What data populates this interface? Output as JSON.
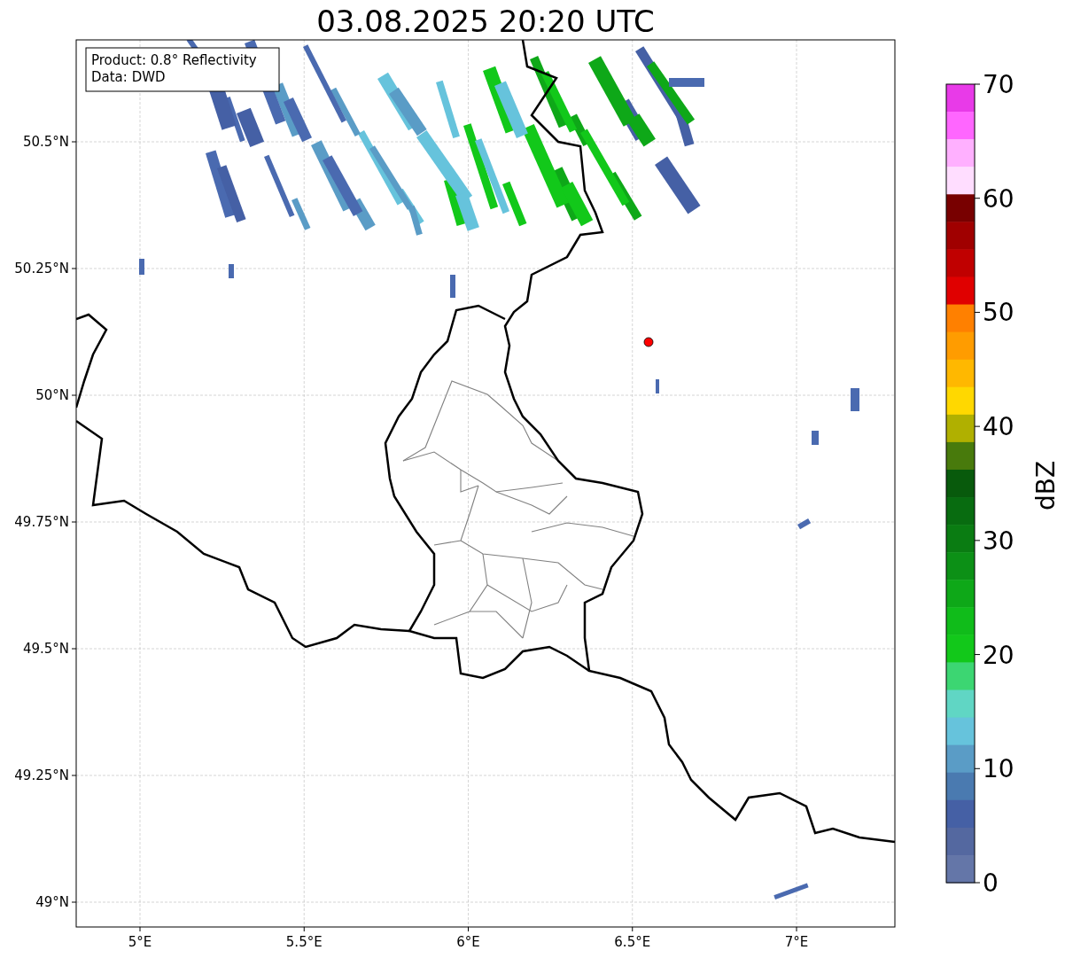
{
  "title": "03.08.2025 20:20 UTC",
  "info_box": {
    "lines": [
      "Product: 0.8° Reflectivity",
      "Data: DWD"
    ]
  },
  "map": {
    "xticks": [
      "5°E",
      "5.5°E",
      "6°E",
      "6.5°E",
      "7°E"
    ],
    "yticks": [
      "50.5°N",
      "50.25°N",
      "50°N",
      "49.75°N",
      "49.5°N",
      "49.25°N",
      "49°N"
    ]
  },
  "colorbar": {
    "label": "dBZ",
    "ticks": [
      "70",
      "60",
      "50",
      "40",
      "30",
      "20",
      "10",
      "0"
    ],
    "segments": [
      {
        "color": "#e83ae8"
      },
      {
        "color": "#ff66ff"
      },
      {
        "color": "#ffb0ff"
      },
      {
        "color": "#ffddff"
      },
      {
        "color": "#780000"
      },
      {
        "color": "#a00000"
      },
      {
        "color": "#c00000"
      },
      {
        "color": "#e00000"
      },
      {
        "color": "#ff8000"
      },
      {
        "color": "#ff9c00"
      },
      {
        "color": "#ffb800"
      },
      {
        "color": "#ffd800"
      },
      {
        "color": "#b0b000"
      },
      {
        "color": "#487a0c"
      },
      {
        "color": "#085a0c"
      },
      {
        "color": "#086c10"
      },
      {
        "color": "#0a7c12"
      },
      {
        "color": "#0c9016"
      },
      {
        "color": "#0ea818"
      },
      {
        "color": "#10bc1a"
      },
      {
        "color": "#12c81a"
      },
      {
        "color": "#3cd672"
      },
      {
        "color": "#60d6c4"
      },
      {
        "color": "#66c3dc"
      },
      {
        "color": "#5a9cc6"
      },
      {
        "color": "#4a7ab0"
      },
      {
        "color": "#4560a5"
      },
      {
        "color": "#5468a0"
      },
      {
        "color": "#6476a8"
      }
    ]
  }
}
